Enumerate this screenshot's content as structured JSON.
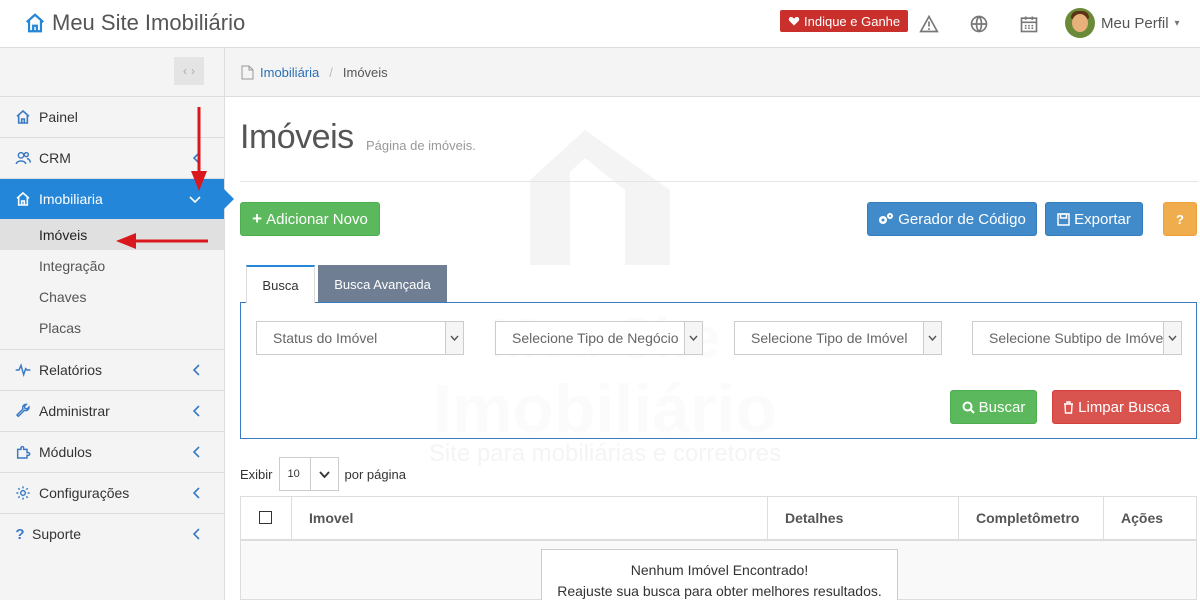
{
  "app": {
    "title": "Meu Site Imobiliário",
    "indique_label": "Indique e Ganhe",
    "profile_label": "Meu Perfil"
  },
  "sidebar": {
    "items": [
      {
        "label": "Painel",
        "icon": "home-icon"
      },
      {
        "label": "CRM",
        "icon": "users-icon"
      },
      {
        "label": "Imobiliaria",
        "icon": "home-icon",
        "active": true
      },
      {
        "label": "Relatórios",
        "icon": "pulse-icon"
      },
      {
        "label": "Administrar",
        "icon": "wrench-icon"
      },
      {
        "label": "Módulos",
        "icon": "puzzle-icon"
      },
      {
        "label": "Configurações",
        "icon": "gear-icon"
      },
      {
        "label": "Suporte",
        "icon": "question-icon"
      }
    ],
    "subitems": [
      {
        "label": "Imóveis",
        "selected": true
      },
      {
        "label": "Integração"
      },
      {
        "label": "Chaves"
      },
      {
        "label": "Placas"
      }
    ]
  },
  "breadcrumb": {
    "root": "Imobiliária",
    "current": "Imóveis"
  },
  "page": {
    "title": "Imóveis",
    "subtitle": "Página de imóveis."
  },
  "toolbar": {
    "add_label": "Adicionar Novo",
    "code_label": "Gerador de Código",
    "export_label": "Exportar",
    "help_label": "?"
  },
  "tabs": [
    {
      "label": "Busca",
      "active": true
    },
    {
      "label": "Busca Avançada"
    }
  ],
  "search": {
    "status_placeholder": "Status do Imóvel",
    "negocio_placeholder": "Selecione Tipo de Negócio",
    "tipo_placeholder": "Selecione Tipo de Imóvel",
    "subtipo_placeholder": "Selecione Subtipo de Imóvel",
    "search_label": "Buscar",
    "clear_label": "Limpar Busca"
  },
  "watermark": {
    "line1": "Meu Site",
    "line2": "Imobiliário",
    "line3": "Site para mobiliárias e corretores"
  },
  "perpage": {
    "prefix": "Exibir",
    "value": "10",
    "suffix": "por página"
  },
  "table": {
    "columns": [
      "Imovel",
      "Detalhes",
      "Completômetro",
      "Ações"
    ],
    "empty_line1": "Nenhum Imóvel Encontrado!",
    "empty_line2": "Reajuste sua busca para obter melhores resultados."
  },
  "colors": {
    "primary": "#2386d8",
    "success": "#5cb85c",
    "info": "#428bca",
    "warning": "#f0ad4e",
    "danger": "#d9534f",
    "arrow": "#d9171c"
  }
}
